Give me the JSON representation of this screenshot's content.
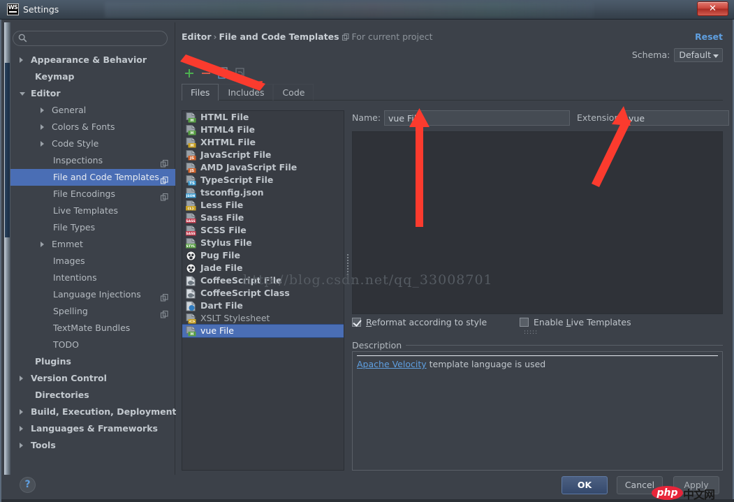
{
  "window": {
    "title": "Settings",
    "app_badge": "WS",
    "close_label": "✕"
  },
  "sidebar": {
    "search": {
      "value": "",
      "placeholder": ""
    },
    "items": [
      {
        "label": "Appearance & Behavior",
        "indent": 12,
        "arrow": "collapsed",
        "bold": true,
        "badge": false,
        "selected": false
      },
      {
        "label": "Keymap",
        "indent": 30,
        "arrow": "none",
        "bold": true,
        "badge": false,
        "selected": false
      },
      {
        "label": "Editor",
        "indent": 12,
        "arrow": "expanded",
        "bold": true,
        "badge": false,
        "selected": false
      },
      {
        "label": "General",
        "indent": 42,
        "arrow": "collapsed",
        "bold": false,
        "badge": false,
        "selected": false
      },
      {
        "label": "Colors & Fonts",
        "indent": 42,
        "arrow": "collapsed",
        "bold": false,
        "badge": false,
        "selected": false
      },
      {
        "label": "Code Style",
        "indent": 42,
        "arrow": "collapsed",
        "bold": false,
        "badge": false,
        "selected": false
      },
      {
        "label": "Inspections",
        "indent": 56,
        "arrow": "none",
        "bold": false,
        "badge": true,
        "selected": false
      },
      {
        "label": "File and Code Templates",
        "indent": 56,
        "arrow": "none",
        "bold": false,
        "badge": true,
        "selected": true
      },
      {
        "label": "File Encodings",
        "indent": 56,
        "arrow": "none",
        "bold": false,
        "badge": true,
        "selected": false
      },
      {
        "label": "Live Templates",
        "indent": 56,
        "arrow": "none",
        "bold": false,
        "badge": false,
        "selected": false
      },
      {
        "label": "File Types",
        "indent": 56,
        "arrow": "none",
        "bold": false,
        "badge": false,
        "selected": false
      },
      {
        "label": "Emmet",
        "indent": 42,
        "arrow": "collapsed",
        "bold": false,
        "badge": false,
        "selected": false
      },
      {
        "label": "Images",
        "indent": 56,
        "arrow": "none",
        "bold": false,
        "badge": false,
        "selected": false
      },
      {
        "label": "Intentions",
        "indent": 56,
        "arrow": "none",
        "bold": false,
        "badge": false,
        "selected": false
      },
      {
        "label": "Language Injections",
        "indent": 56,
        "arrow": "none",
        "bold": false,
        "badge": true,
        "selected": false
      },
      {
        "label": "Spelling",
        "indent": 56,
        "arrow": "none",
        "bold": false,
        "badge": true,
        "selected": false
      },
      {
        "label": "TextMate Bundles",
        "indent": 56,
        "arrow": "none",
        "bold": false,
        "badge": false,
        "selected": false
      },
      {
        "label": "TODO",
        "indent": 56,
        "arrow": "none",
        "bold": false,
        "badge": false,
        "selected": false
      },
      {
        "label": "Plugins",
        "indent": 30,
        "arrow": "none",
        "bold": true,
        "badge": false,
        "selected": false
      },
      {
        "label": "Version Control",
        "indent": 12,
        "arrow": "collapsed",
        "bold": true,
        "badge": false,
        "selected": false
      },
      {
        "label": "Directories",
        "indent": 30,
        "arrow": "none",
        "bold": true,
        "badge": false,
        "selected": false
      },
      {
        "label": "Build, Execution, Deployment",
        "indent": 12,
        "arrow": "collapsed",
        "bold": true,
        "badge": false,
        "selected": false
      },
      {
        "label": "Languages & Frameworks",
        "indent": 12,
        "arrow": "collapsed",
        "bold": true,
        "badge": false,
        "selected": false
      },
      {
        "label": "Tools",
        "indent": 12,
        "arrow": "collapsed",
        "bold": true,
        "badge": false,
        "selected": false
      }
    ]
  },
  "header": {
    "breadcrumb_root": "Editor",
    "breadcrumb_sep": "›",
    "breadcrumb_current": "File and Code Templates",
    "scope_note": "For current project",
    "reset_label": "Reset",
    "schema_label": "Schema:",
    "schema_value": "Default"
  },
  "toolbar": {
    "add_label": "+",
    "remove_label": "−",
    "copy_name": "copy-template-icon",
    "reset_name": "reset-template-icon"
  },
  "tabs": [
    {
      "label": "Files",
      "active": true
    },
    {
      "label": "Includes",
      "active": false
    },
    {
      "label": "Code",
      "active": false
    }
  ],
  "template_list": [
    {
      "label": "HTML File",
      "icon": "html",
      "selected": false
    },
    {
      "label": "HTML4 File",
      "icon": "html",
      "selected": false
    },
    {
      "label": "XHTML File",
      "icon": "xhtml",
      "selected": false
    },
    {
      "label": "JavaScript File",
      "icon": "js",
      "selected": false
    },
    {
      "label": "AMD JavaScript File",
      "icon": "js",
      "selected": false
    },
    {
      "label": "TypeScript File",
      "icon": "ts",
      "selected": false
    },
    {
      "label": "tsconfig.json",
      "icon": "json",
      "selected": false
    },
    {
      "label": "Less File",
      "icon": "less",
      "selected": false
    },
    {
      "label": "Sass File",
      "icon": "sass",
      "selected": false
    },
    {
      "label": "SCSS File",
      "icon": "sass",
      "selected": false
    },
    {
      "label": "Stylus File",
      "icon": "styl",
      "selected": false
    },
    {
      "label": "Pug File",
      "icon": "pug",
      "selected": false
    },
    {
      "label": "Jade File",
      "icon": "pug",
      "selected": false
    },
    {
      "label": "CoffeeScript File",
      "icon": "coffee",
      "selected": false
    },
    {
      "label": "CoffeeScript Class",
      "icon": "coffee",
      "selected": false
    },
    {
      "label": "Dart File",
      "icon": "dart",
      "selected": false
    },
    {
      "label": "XSLT Stylesheet",
      "icon": "xslt",
      "selected": false,
      "dim": true
    },
    {
      "label": "vue File",
      "icon": "html",
      "selected": true,
      "dim": true
    }
  ],
  "details": {
    "name_label": "Name:",
    "name_value": "vue File",
    "extension_label": "Extension:",
    "extension_value": "vue",
    "editor_content": "",
    "reformat_label": "Reformat according to style",
    "reformat_mnemonic": "R",
    "reformat_checked": true,
    "live_templates_label": "Enable Live Templates",
    "live_templates_mnemonic": "L",
    "live_templates_checked": false,
    "description_title": "Description",
    "description_link": "Apache Velocity",
    "description_rest": " template language is used"
  },
  "watermark": {
    "url": "http://blog.csdn.net/qq_33008701",
    "brand_php": "php",
    "brand_cn": "中文网"
  },
  "footer": {
    "help_label": "?",
    "ok_label": "OK",
    "cancel_label": "Cancel",
    "apply_label": "Apply"
  },
  "colors": {
    "accent_selection": "#4a6eb5",
    "link": "#5f9fe0",
    "add_icon": "#4caf50",
    "remove_icon": "#d35b4a",
    "panel_bg": "#3c4149",
    "editor_bg": "#2f3238"
  }
}
